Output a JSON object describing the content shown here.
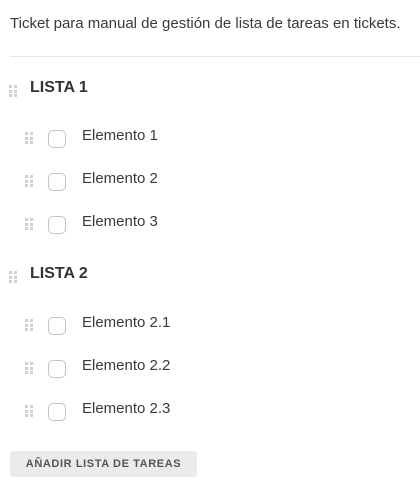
{
  "ticket": {
    "description": "Ticket para manual de gestión de lista de tareas en tickets."
  },
  "checklists": [
    {
      "title": "LISTA 1",
      "items": [
        {
          "label": "Elemento 1",
          "checked": false
        },
        {
          "label": "Elemento 2",
          "checked": false
        },
        {
          "label": "Elemento 3",
          "checked": false
        }
      ]
    },
    {
      "title": "LISTA 2",
      "items": [
        {
          "label": "Elemento 2.1",
          "checked": false
        },
        {
          "label": "Elemento 2.2",
          "checked": false
        },
        {
          "label": "Elemento 2.3",
          "checked": false
        }
      ]
    }
  ],
  "actions": {
    "add_checklist_label": "AÑADIR LISTA DE TAREAS"
  },
  "icons": {
    "drag_handle": "drag-handle-icon"
  },
  "colors": {
    "text": "#333333",
    "checkbox_border": "#c4c4c4",
    "handle": "#d0d0d0",
    "button_bg": "#ebebeb",
    "button_text": "#555555",
    "divider": "#e6e6e6"
  }
}
